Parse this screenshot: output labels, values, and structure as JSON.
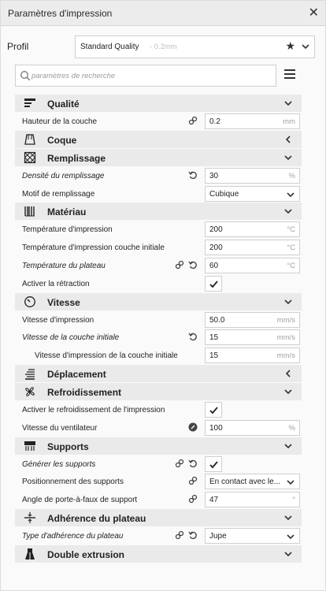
{
  "window": {
    "title": "Paramètres d'impression",
    "close_icon": "close-icon"
  },
  "profile": {
    "label": "Profil",
    "name": "Standard Quality",
    "detail": "- 0.2mm"
  },
  "search": {
    "placeholder": "paramètres de recherche"
  },
  "sections": {
    "qualite": {
      "label": "Qualité",
      "expanded": true
    },
    "coque": {
      "label": "Coque",
      "expanded": false
    },
    "remplissage": {
      "label": "Remplissage",
      "expanded": true
    },
    "materiau": {
      "label": "Matériau",
      "expanded": true
    },
    "vitesse": {
      "label": "Vitesse",
      "expanded": true
    },
    "deplacement": {
      "label": "Déplacement",
      "expanded": false
    },
    "refroidissement": {
      "label": "Refroidissement",
      "expanded": true
    },
    "supports": {
      "label": "Supports",
      "expanded": true
    },
    "adherence": {
      "label": "Adhérence du plateau",
      "expanded": true
    },
    "double": {
      "label": "Double extrusion",
      "expanded": true
    }
  },
  "settings": {
    "layer_height": {
      "label": "Hauteur de la couche",
      "value": "0.2",
      "unit": "mm"
    },
    "infill_density": {
      "label": "Densité du remplissage",
      "value": "30",
      "unit": "%"
    },
    "infill_pattern": {
      "label": "Motif de remplissage",
      "value": "Cubique"
    },
    "print_temp": {
      "label": "Température d'impression",
      "value": "200",
      "unit": "°C"
    },
    "print_temp_initial": {
      "label": "Température d'impression couche initiale",
      "value": "200",
      "unit": "°C"
    },
    "bed_temp": {
      "label": "Température du plateau",
      "value": "60",
      "unit": "°C"
    },
    "retraction": {
      "label": "Activer la rétraction",
      "checked": true
    },
    "print_speed": {
      "label": "Vitesse d'impression",
      "value": "50.0",
      "unit": "mm/s"
    },
    "initial_layer_speed": {
      "label": "Vitesse de la couche initiale",
      "value": "15",
      "unit": "mm/s"
    },
    "initial_layer_print_speed": {
      "label": "Vitesse d'impression de la couche initiale",
      "value": "15",
      "unit": "mm/s"
    },
    "cooling": {
      "label": "Activer le refroidissement de l'impression",
      "checked": true
    },
    "fan_speed": {
      "label": "Vitesse du ventilateur",
      "value": "100",
      "unit": "%"
    },
    "gen_supports": {
      "label": "Générer les supports",
      "checked": true
    },
    "support_placement": {
      "label": "Positionnement des supports",
      "value": "En contact avec le..."
    },
    "overhang_angle": {
      "label": "Angle de porte-à-faux de support",
      "value": "47",
      "unit": "°"
    },
    "adhesion_type": {
      "label": "Type d'adhérence du plateau",
      "value": "Jupe"
    }
  }
}
